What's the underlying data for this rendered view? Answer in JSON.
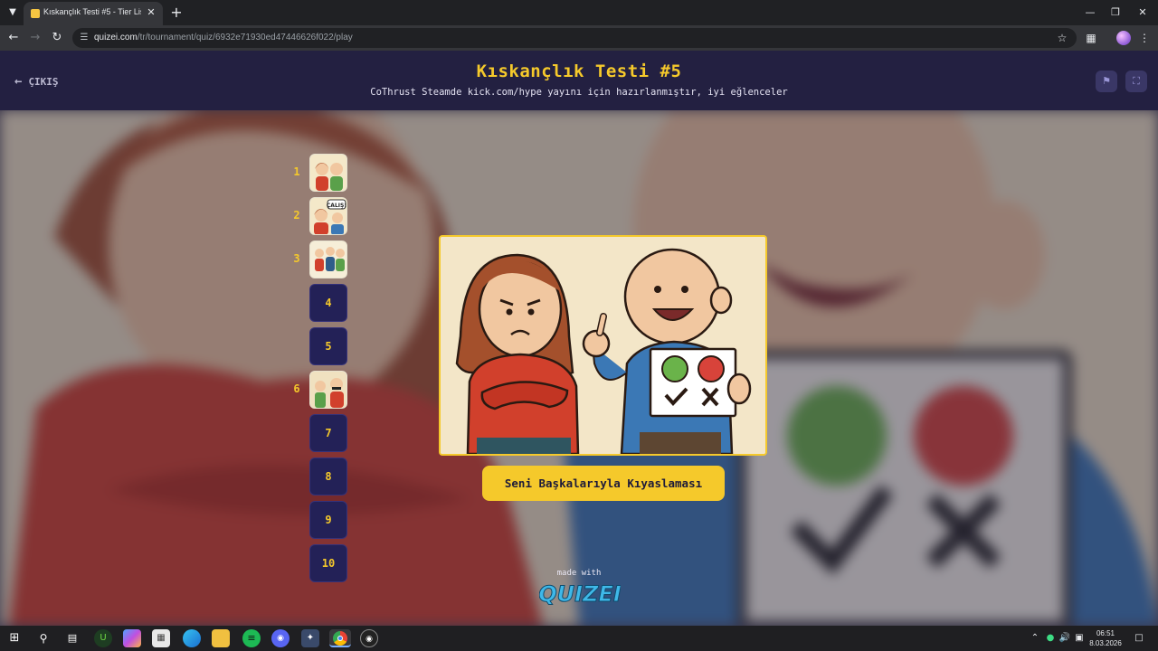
{
  "browser": {
    "tab_title": "Kıskançlık Testi #5 - Tier List, Kı",
    "url_host": "quizei.com",
    "url_path": "/tr/tournament/quiz/6932e71930ed47446626f022/play",
    "icons": [
      "tab-search-icon",
      "favicon-icon",
      "close-icon",
      "plus-icon",
      "minimize-icon",
      "restore-icon",
      "close-window-icon",
      "back-icon",
      "forward-icon",
      "reload-icon",
      "site-info-icon",
      "star-icon",
      "extensions-icon",
      "profile-avatar",
      "kebab-menu-icon"
    ]
  },
  "header": {
    "exit_label": "ÇIKIŞ",
    "title": "Kıskançlık Testi #5",
    "subtitle": "CoThrust Steamde kick.com/hype yayını için hazırlanmıştır, iyi eğlenceler",
    "icons": [
      "arrow-left-icon",
      "flag-icon",
      "fullscreen-icon"
    ]
  },
  "rounds": [
    {
      "number": "1",
      "has_image": true
    },
    {
      "number": "2",
      "has_image": true
    },
    {
      "number": "3",
      "has_image": true
    },
    {
      "number": "4",
      "has_image": false
    },
    {
      "number": "5",
      "has_image": false
    },
    {
      "number": "6",
      "has_image": true
    },
    {
      "number": "7",
      "has_image": false
    },
    {
      "number": "8",
      "has_image": false
    },
    {
      "number": "9",
      "has_image": false
    },
    {
      "number": "10",
      "has_image": false
    }
  ],
  "current_item": {
    "label": "Seni Başkalarıyla Kıyaslaması",
    "thumb_text_round2": "ÇALIŞ!"
  },
  "footer": {
    "made_with": "made with",
    "brand": "QUIZEI"
  },
  "taskbar": {
    "time": "06:51",
    "date": "8.03.2026",
    "apps": [
      "windows-start-icon",
      "search-icon",
      "task-view-icon",
      "upwork-icon",
      "copilot-icon",
      "store-icon",
      "edge-icon",
      "file-explorer-icon",
      "spotify-icon",
      "discord-icon",
      "game-icon",
      "chrome-icon",
      "obs-icon"
    ]
  },
  "colors": {
    "accent": "#f5c92b",
    "header_bg": "#232041",
    "round_box": "#232157"
  }
}
